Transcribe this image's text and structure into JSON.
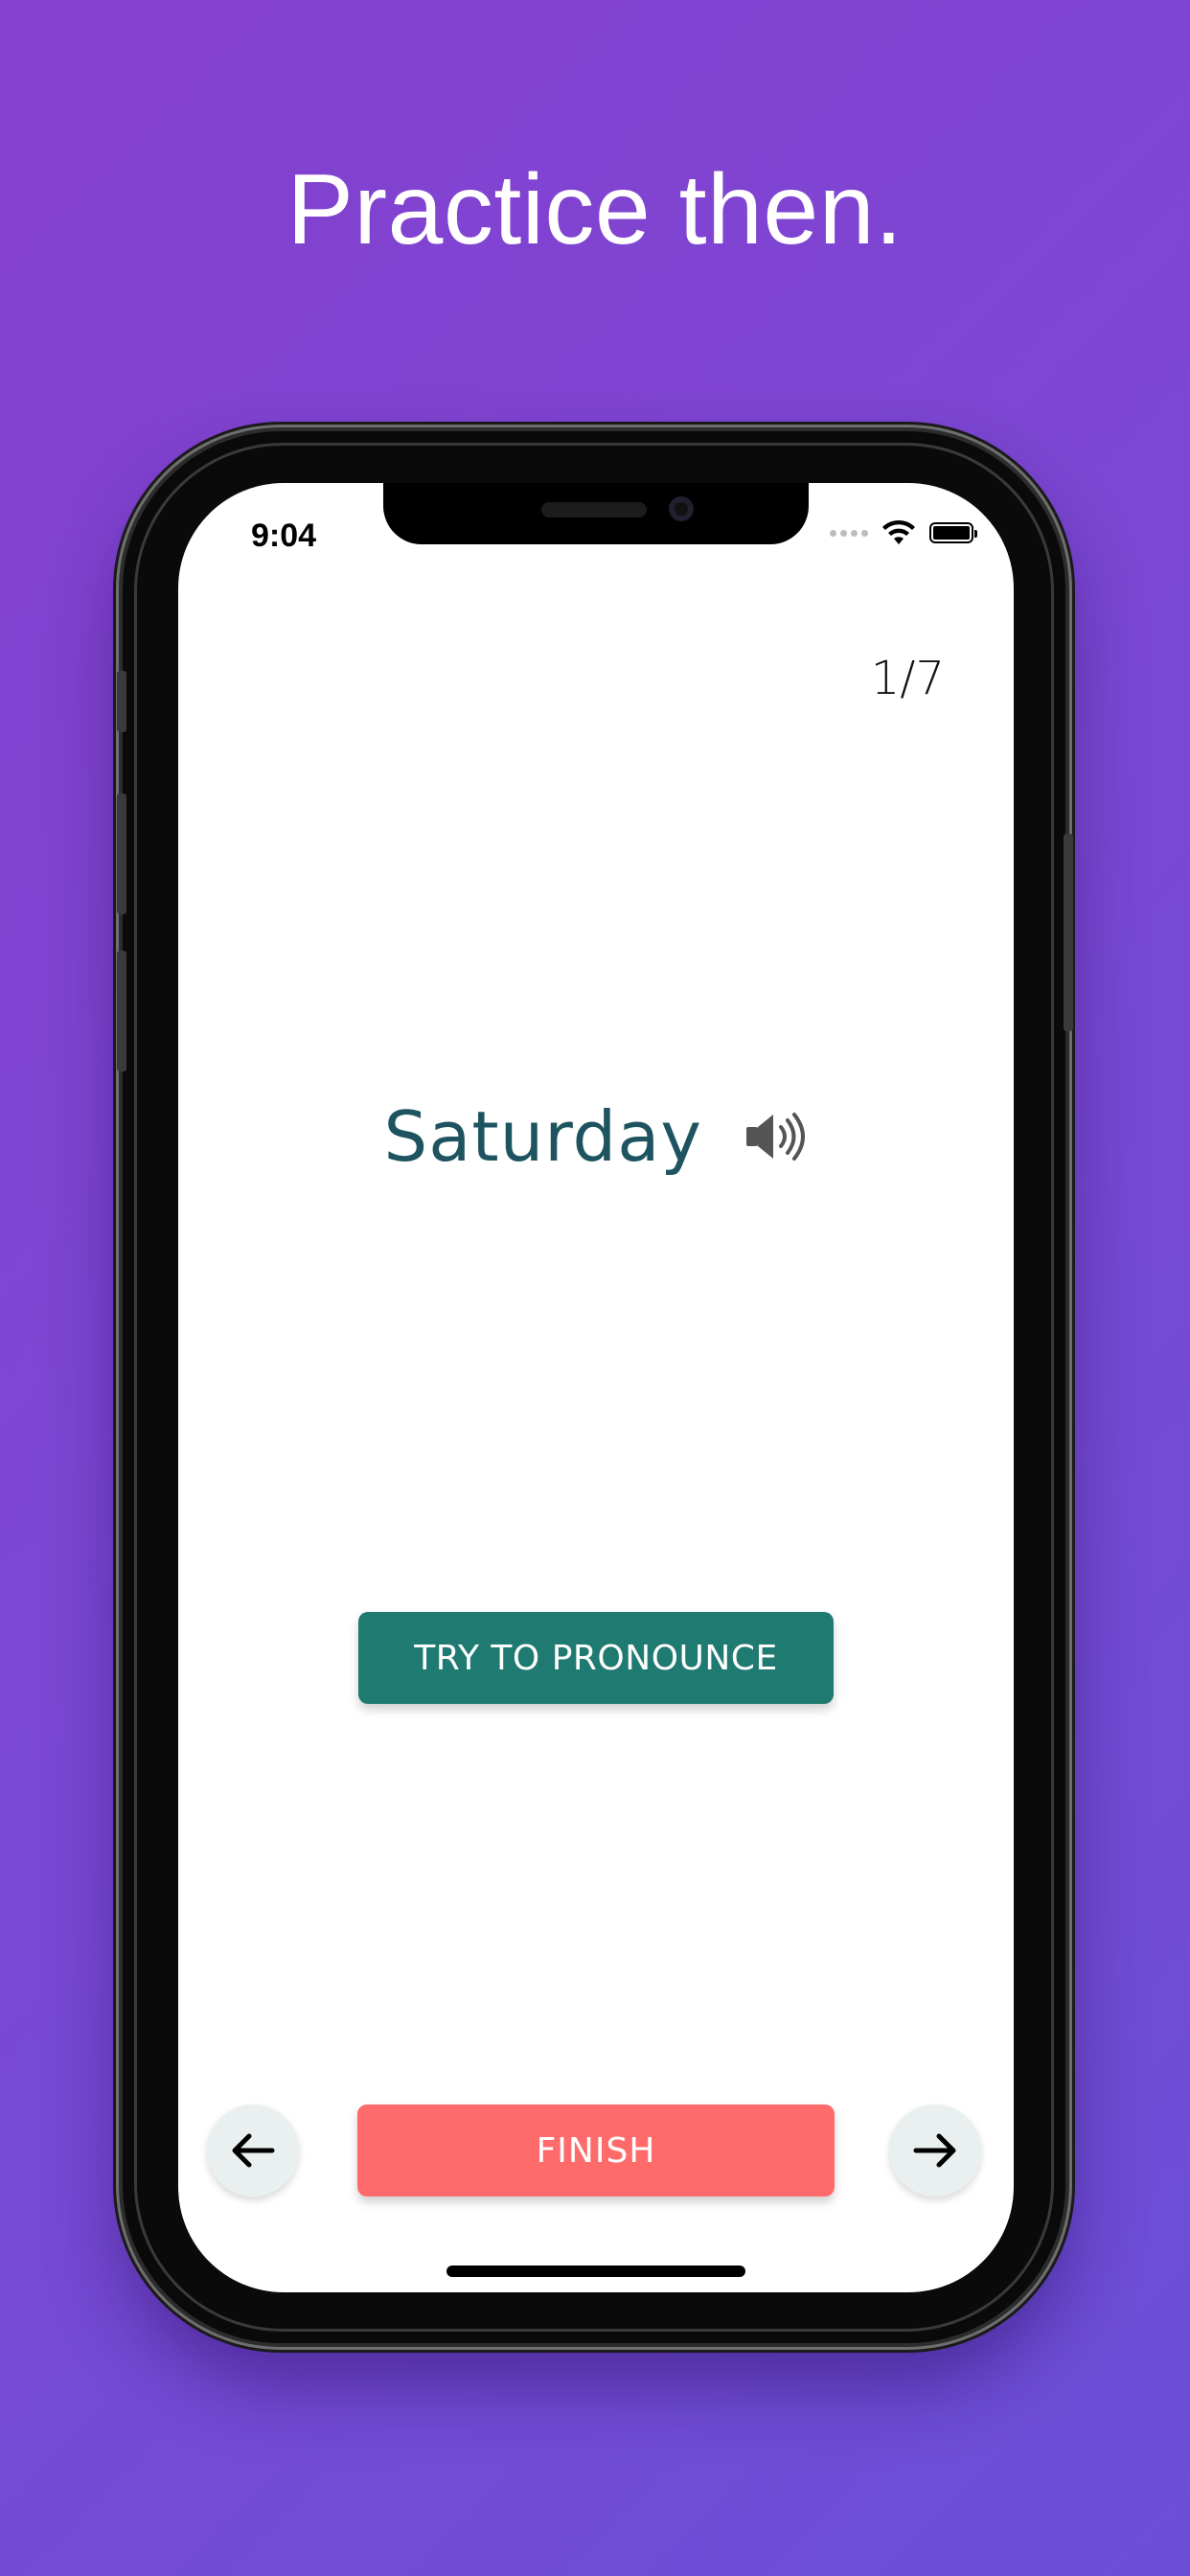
{
  "marketing": {
    "headline": "Practice then."
  },
  "status_bar": {
    "time": "9:04",
    "icons": [
      "signal-dots-icon",
      "wifi-icon",
      "battery-icon"
    ]
  },
  "lesson": {
    "counter": "1/7",
    "word": "Saturday",
    "play_audio_icon": "speaker-icon"
  },
  "actions": {
    "pronounce_label": "TRY TO PRONOUNCE",
    "finish_label": "FINISH",
    "prev_icon": "arrow-left-icon",
    "next_icon": "arrow-right-icon"
  },
  "colors": {
    "background_gradient": [
      "#8540cf",
      "#6a4fd6"
    ],
    "word_color": "#1e5360",
    "pronounce_button": "#1f7a71",
    "finish_button": "#ff6b6b",
    "nav_button": "#eaf0f0"
  }
}
